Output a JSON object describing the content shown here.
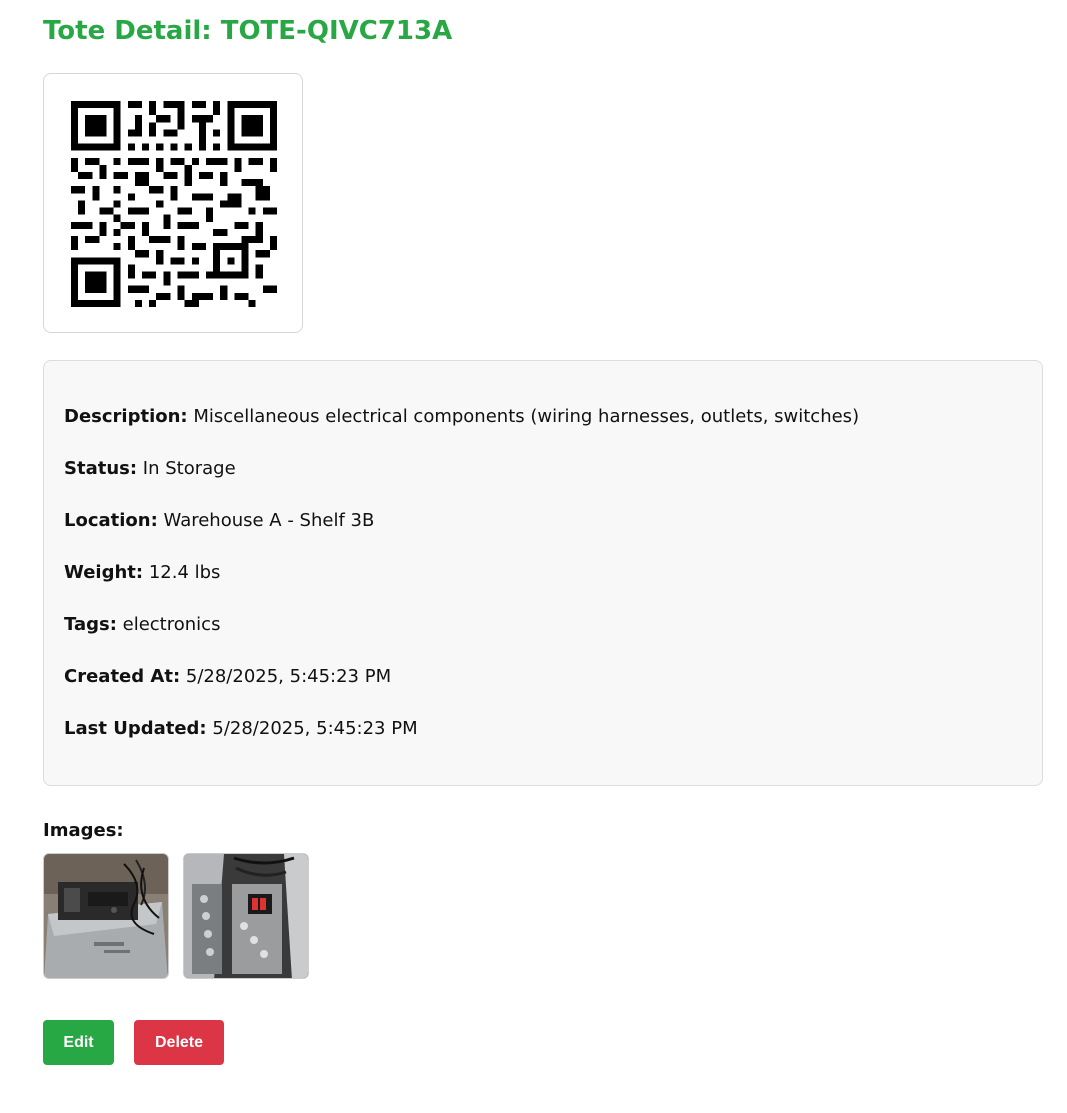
{
  "title": "Tote Detail: TOTE-QIVC713A",
  "qr": {
    "icon": "qr-code-icon"
  },
  "details": [
    {
      "label": "Description:",
      "value": "Miscellaneous electrical components (wiring harnesses, outlets, switches)"
    },
    {
      "label": "Status:",
      "value": "In Storage"
    },
    {
      "label": "Location:",
      "value": "Warehouse A - Shelf 3B"
    },
    {
      "label": "Weight:",
      "value": "12.4 lbs"
    },
    {
      "label": "Tags:",
      "value": "electronics"
    },
    {
      "label": "Created At:",
      "value": "5/28/2025, 5:45:23 PM"
    },
    {
      "label": "Last Updated:",
      "value": "5/28/2025, 5:45:23 PM"
    }
  ],
  "images": {
    "label": "Images:"
  },
  "actions": {
    "edit_label": "Edit",
    "delete_label": "Delete"
  },
  "colors": {
    "accent": "#28a745",
    "danger": "#dc3545",
    "card_bg": "#f8f8f8"
  }
}
